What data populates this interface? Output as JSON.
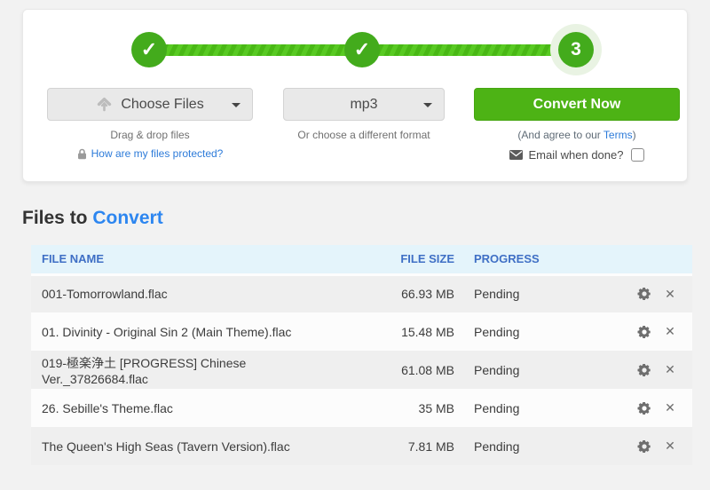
{
  "stepper": {
    "step1": "✓",
    "step2": "✓",
    "step3": "3"
  },
  "controls": {
    "choose_files": {
      "label": "Choose Files",
      "hint": "Drag & drop files",
      "protect_link": "How are my files protected?"
    },
    "format": {
      "value": "mp3",
      "hint": "Or choose a different format"
    },
    "convert": {
      "label": "Convert Now",
      "agree_prefix": "(And agree to our ",
      "terms_label": "Terms",
      "agree_suffix": ")",
      "email_label": "Email when done?"
    }
  },
  "heading": {
    "prefix": "Files to",
    "highlight": "Convert"
  },
  "table": {
    "headers": [
      "FILE NAME",
      "FILE SIZE",
      "PROGRESS"
    ],
    "rows": [
      {
        "name": "001-Tomorrowland.flac",
        "size": "66.93 MB",
        "status": "Pending"
      },
      {
        "name": "01. Divinity - Original Sin 2 (Main Theme).flac",
        "size": "15.48 MB",
        "status": "Pending"
      },
      {
        "name": "019-極楽浄土 [PROGRESS] Chinese Ver._37826684.flac",
        "size": "61.08 MB",
        "status": "Pending"
      },
      {
        "name": "26. Sebille's Theme.flac",
        "size": "35 MB",
        "status": "Pending"
      },
      {
        "name": "The Queen's High Seas (Tavern Version).flac",
        "size": "7.81 MB",
        "status": "Pending"
      }
    ]
  },
  "icons": {
    "close": "✕"
  },
  "colors": {
    "step_green": "#43ab1c",
    "rope_green": "#58ca22",
    "convert_green": "#4db315",
    "brand_blue": "#2d86f0",
    "header_blue": "#3f6fc5",
    "link_blue": "#2d7bd9",
    "header_bg": "#e4f4fb",
    "row_stripe": "#efefef"
  }
}
